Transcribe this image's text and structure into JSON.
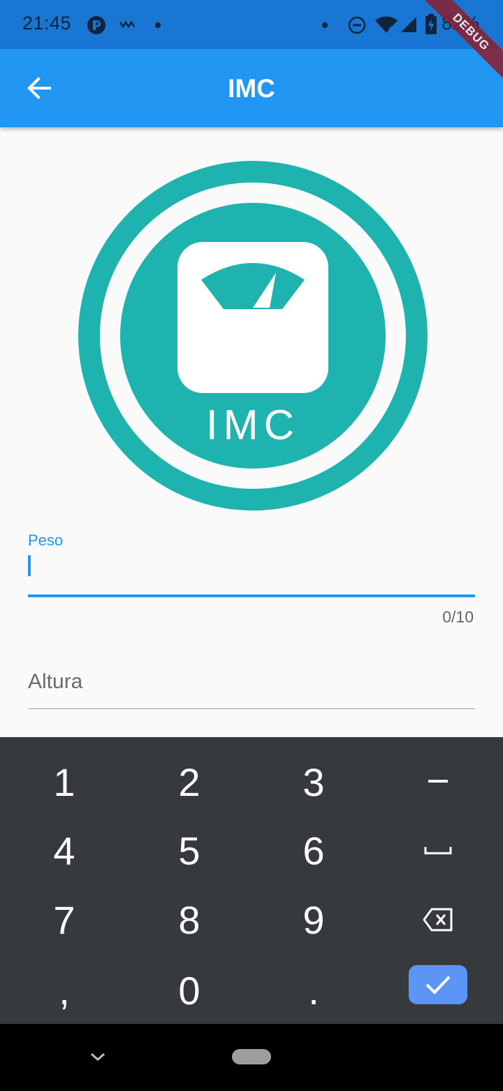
{
  "status_bar": {
    "time": "21:45",
    "battery_percent": "82%",
    "icons": [
      "p-app-icon",
      "wavy-icon",
      "dot-icon",
      "dot-icon",
      "do-not-disturb-icon",
      "wifi-icon",
      "signal-4g-icon",
      "battery-charging-icon"
    ]
  },
  "debug_banner": "DEBUG",
  "app_bar": {
    "title": "IMC",
    "back_icon": "arrow-left-icon",
    "background": "#2196f3"
  },
  "logo": {
    "text": "IMC",
    "color": "#1fb3b0",
    "icon": "scale-icon"
  },
  "form": {
    "peso": {
      "label": "Peso",
      "value": "",
      "counter": "0/10"
    },
    "altura": {
      "placeholder": "Altura",
      "value": ""
    },
    "accent": "#2196f3"
  },
  "keyboard": {
    "row1": [
      "1",
      "2",
      "3",
      "−"
    ],
    "row2": [
      "4",
      "5",
      "6",
      "␣"
    ],
    "row3": [
      "7",
      "8",
      "9",
      "backspace"
    ],
    "row4": [
      ",",
      "0",
      "."
    ],
    "enter_icon": "check-icon",
    "enter_color": "#5c95f5",
    "background": "#363a3f"
  },
  "nav_bar": {
    "back_icon": "chevron-down-icon",
    "home_icon": "home-pill-icon"
  }
}
